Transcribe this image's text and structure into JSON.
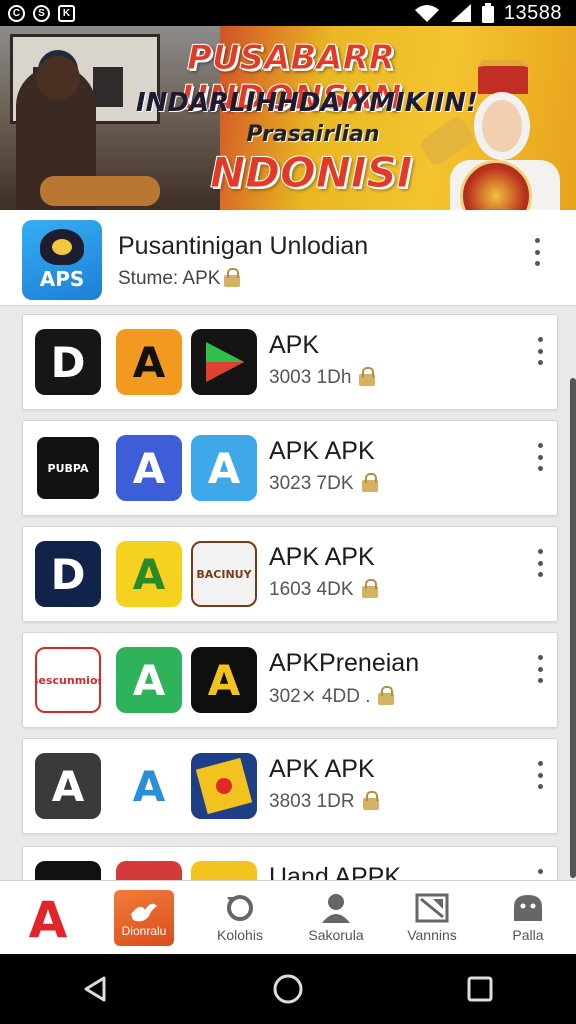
{
  "status_bar": {
    "left_icons": [
      "C",
      "S",
      "K"
    ],
    "time": "13588"
  },
  "banner": {
    "line1": "PUSABARR UNDONSAN",
    "line2": "INDARLIHHDAIYMIKIIN!",
    "line3": "Prasairlian",
    "line4": "NDONISI"
  },
  "header_app": {
    "icon_label": "APS",
    "title": "Pusantinigan Unlodian",
    "subtitle": "Stume: APK"
  },
  "list": [
    {
      "title": "APK",
      "subtitle": "3003 1Dh",
      "icons": [
        {
          "name": "dark-d-logo-icon",
          "text": "D",
          "bg": "#161616",
          "fg": "#ffffff"
        },
        {
          "name": "orange-a-logo-icon",
          "text": "A",
          "bg": "#f29a1f",
          "fg": "#111111"
        },
        {
          "name": "play-triangle-icon",
          "text": "",
          "bg": "#141414",
          "fg": "#2fbf4a"
        }
      ]
    },
    {
      "title": "APK APK",
      "subtitle": "3023 7DK",
      "icons": [
        {
          "name": "pubpa-logo-icon",
          "text": "PUBPA",
          "bg": "#111111",
          "fg": "#ffffff"
        },
        {
          "name": "blue-a-logo-icon",
          "text": "A",
          "bg": "#3d5ed6",
          "fg": "#ffffff"
        },
        {
          "name": "light-blue-a-logo-icon",
          "text": "A",
          "bg": "#3fa8e8",
          "fg": "#ffffff"
        }
      ]
    },
    {
      "title": "APK APK",
      "subtitle": "1603 4DK",
      "icons": [
        {
          "name": "navy-d-logo-icon",
          "text": "D",
          "bg": "#11234a",
          "fg": "#ffffff"
        },
        {
          "name": "yellow-a-logo-icon",
          "text": "A",
          "bg": "#f5d21f",
          "fg": "#2a8a2a"
        },
        {
          "name": "badge-emblem-icon",
          "text": "BACINUY",
          "bg": "#f2f2f2",
          "fg": "#7a3a15"
        }
      ]
    },
    {
      "title": "APKPreneian",
      "subtitle": "302⨯ 4DD .",
      "icons": [
        {
          "name": "red-circle-logo-icon",
          "text": "sescunmios",
          "bg": "#ffffff",
          "fg": "#d42a2a"
        },
        {
          "name": "green-a-logo-icon",
          "text": "A",
          "bg": "#2fb35a",
          "fg": "#ffffff"
        },
        {
          "name": "black-yellow-a-logo-icon",
          "text": "A",
          "bg": "#0f0f0f",
          "fg": "#f2c21f"
        }
      ]
    },
    {
      "title": "APK APK",
      "subtitle": "3803 1DR",
      "icons": [
        {
          "name": "grey-a-logo-icon",
          "text": "A",
          "bg": "#3a3a3a",
          "fg": "#ffffff"
        },
        {
          "name": "circle-a-logo-icon",
          "text": "A",
          "bg": "#ffffff",
          "fg": "#2a8fd6"
        },
        {
          "name": "card-logo-icon",
          "text": "",
          "bg": "#1e3f86",
          "fg": "#f2c21f"
        }
      ]
    },
    {
      "title": "Uand APPK",
      "subtitle": "",
      "icons": [
        {
          "name": "partial-dark-icon",
          "text": "",
          "bg": "#111111",
          "fg": "#ffffff"
        },
        {
          "name": "partial-red-icon",
          "text": "",
          "bg": "#d43a3a",
          "fg": "#ffffff"
        },
        {
          "name": "partial-yellow-icon",
          "text": "",
          "bg": "#f2c21f",
          "fg": "#111111"
        }
      ]
    }
  ],
  "bottom_nav": [
    {
      "label": "",
      "icon": "red-a-logo-icon"
    },
    {
      "label": "Dionralu",
      "icon": "orange-bird-tile-icon"
    },
    {
      "label": "Kolohis",
      "icon": "refresh-icon"
    },
    {
      "label": "Sakorula",
      "icon": "person-icon"
    },
    {
      "label": "Vannins",
      "icon": "image-icon"
    },
    {
      "label": "Palla",
      "icon": "ghost-icon"
    }
  ],
  "colors": {
    "accent_red": "#e1262b",
    "accent_orange": "#e8692a",
    "lock_gold": "#d4b163"
  }
}
